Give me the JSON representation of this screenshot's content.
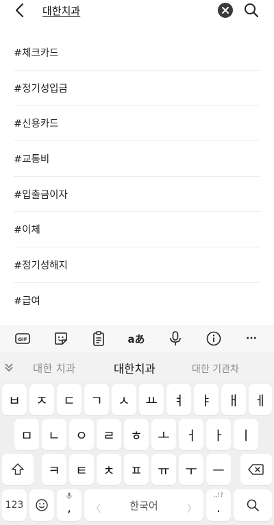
{
  "header": {
    "query": "대한치과"
  },
  "suggestions": [
    "#체크카드",
    "#정기성입금",
    "#신용카드",
    "#교통비",
    "#입출금이자",
    "#이체",
    "#정기성해지",
    "#급여"
  ],
  "toolbar": {
    "gif_label": "GIF",
    "translate_label": "aあ",
    "more_label": "···"
  },
  "candidates": {
    "left": "대한 치과",
    "center": "대한치과",
    "right": "대한 기관차"
  },
  "keyboard": {
    "row1": [
      "ㅂ",
      "ㅈ",
      "ㄷ",
      "ㄱ",
      "ㅅ",
      "ㅛ",
      "ㅕ",
      "ㅑ",
      "ㅐ",
      "ㅔ"
    ],
    "row2": [
      "ㅁ",
      "ㄴ",
      "ㅇ",
      "ㄹ",
      "ㅎ",
      "ㅗ",
      "ㅓ",
      "ㅏ",
      "ㅣ"
    ],
    "row3": [
      "ㅋ",
      "ㅌ",
      "ㅊ",
      "ㅍ",
      "ㅠ",
      "ㅜ",
      "ㅡ"
    ],
    "numbers_label": "123",
    "comma_label": ",",
    "space_label": "한국어",
    "period_sub": ".,!?",
    "period_label": "."
  }
}
